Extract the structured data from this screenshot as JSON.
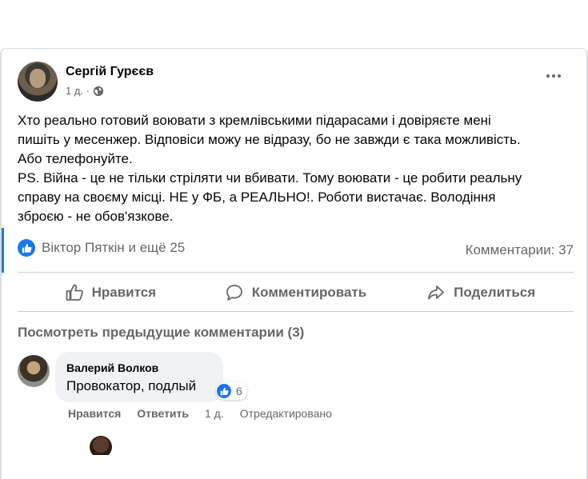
{
  "post": {
    "author": "Сергій Гурєєв",
    "time": "1 д. ·",
    "text": "Хто реально готовий воювати з кремлівськими підарасами і довіряєте мені\nпишіть у месенжер. Відповіси можу не відразу, бо не завжди є така можливість.\nАбо телефонуйте.\nPS. Війна - це не тільки стріляти чи вбивати. Тому воювати - це робити реальну\nсправу на своєму місці. НЕ у ФБ, а РЕАЛЬНО!. Роботи вистачає. Володіння\nзброєю - не обов'язкове.",
    "reactions": "Віктор Пяткін и ещё 25",
    "comments_count": "Комментарии: 37"
  },
  "actions": {
    "like": "Нравится",
    "comment": "Комментировать",
    "share": "Поделиться"
  },
  "comments": {
    "view_previous": "Посмотреть предыдущие комментарии (3)",
    "first": {
      "author": "Валерий Волков",
      "text": "Провокатор, подлый",
      "reaction_count": "6",
      "like": "Нравится",
      "reply": "Ответить",
      "time": "1 д.",
      "edited": "Отредактировано"
    }
  },
  "colors": {
    "accent": "#1877f2",
    "muted": "#65676b",
    "bubble": "#f0f2f5"
  }
}
